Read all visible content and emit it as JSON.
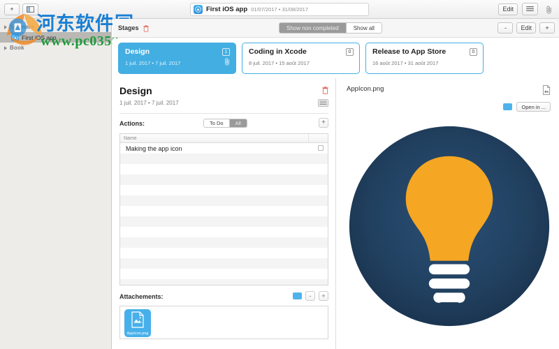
{
  "toolbar": {
    "add_label": "+",
    "sidebar_toggle_icon": "sidebar-toggle-icon",
    "project_title": "First iOS app",
    "project_dates": "01/07/2017 • 31/08/2017",
    "project_icon": "ios-app-icon",
    "edit_label": "Edit",
    "list_icon": "list-view-icon",
    "attachment_icon": "paperclip-icon"
  },
  "sidebar": {
    "items": [
      {
        "label": "Software",
        "type": "group",
        "icon": "disclosure-triangle-icon"
      },
      {
        "label": "First iOS app",
        "type": "project",
        "icon": "ios-app-icon",
        "selected": true
      },
      {
        "label": "Book",
        "type": "group",
        "icon": "disclosure-triangle-icon"
      }
    ]
  },
  "watermark": {
    "chinese": "河东软件园",
    "url": "www.pc0359.cn",
    "colors": {
      "chinese": "#1a7fd4",
      "url": "#1f9a3c",
      "logo_orange": "#f08a28",
      "logo_blue": "#2f8fd8"
    }
  },
  "stagebar": {
    "label": "Stages",
    "trash_icon": "trash-icon",
    "filter": {
      "options": [
        "Show non completed",
        "Show all"
      ],
      "selected": "Show all"
    },
    "minus_label": "-",
    "edit_label": "Edit",
    "plus_label": "+"
  },
  "stages": [
    {
      "title": "Design",
      "dates": "1 juil. 2017 • 7 juil. 2017",
      "count": "1",
      "active": true,
      "clip_icon": "paperclip-icon"
    },
    {
      "title": "Coding in Xcode",
      "dates": "8 juil. 2017 • 15 août 2017",
      "count": "0",
      "active": false
    },
    {
      "title": "Release to App Store",
      "dates": "16 août 2017 • 31 août 2017",
      "count": "0",
      "active": false
    }
  ],
  "detail": {
    "title": "Design",
    "dates": "1 juil. 2017 • 7 juil. 2017",
    "trash_icon": "trash-icon",
    "notes_icon": "notes-list-icon",
    "actions": {
      "label": "Actions:",
      "filter_options": [
        "To Do",
        "All"
      ],
      "filter_selected": "All",
      "add_label": "+",
      "columns": [
        "Name",
        ""
      ],
      "rows": [
        {
          "name": "Making the app icon",
          "done": false
        }
      ],
      "empty_row_count": 13
    },
    "attachments": {
      "label": "Attachements:",
      "folder_icon": "folder-icon",
      "minus_label": "-",
      "plus_label": "+",
      "items": [
        {
          "name": "AppIcon.png",
          "icon": "image-document-icon"
        }
      ]
    }
  },
  "preview": {
    "title": "AppIcon.png",
    "doc_icon": "image-document-icon",
    "folder_icon": "folder-icon",
    "open_label": "Open in ...",
    "image": {
      "name": "lightbulb-app-icon",
      "background": "#1f3b5c",
      "bulb_color": "#f5a623",
      "base_color": "#ffffff"
    }
  },
  "colors": {
    "accent_blue": "#43aee2",
    "sidebar_bg": "#eeece8",
    "toolbar_bg": "#f1f1f1",
    "trash_red": "#e0675e"
  }
}
